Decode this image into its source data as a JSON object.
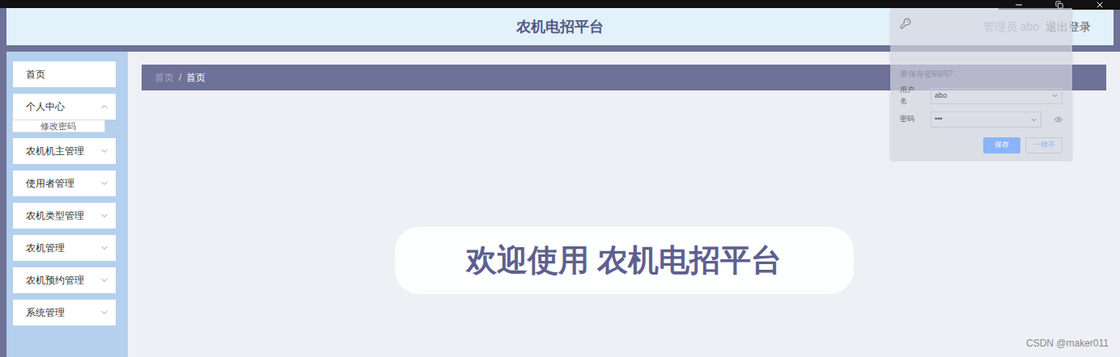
{
  "header": {
    "title": "农机电招平台",
    "user_label": "管理员 abo",
    "logout": "退出登录"
  },
  "sidebar": {
    "items": [
      {
        "label": "首页",
        "kind": "link",
        "expanded": false,
        "children": []
      },
      {
        "label": "个人中心",
        "kind": "menu",
        "expanded": true,
        "children": [
          "修改密码"
        ]
      },
      {
        "label": "农机机主管理",
        "kind": "menu",
        "expanded": false,
        "children": []
      },
      {
        "label": "使用者管理",
        "kind": "menu",
        "expanded": false,
        "children": []
      },
      {
        "label": "农机类型管理",
        "kind": "menu",
        "expanded": false,
        "children": []
      },
      {
        "label": "农机管理",
        "kind": "menu",
        "expanded": false,
        "children": []
      },
      {
        "label": "农机预约管理",
        "kind": "menu",
        "expanded": false,
        "children": []
      },
      {
        "label": "系统管理",
        "kind": "menu",
        "expanded": false,
        "children": []
      }
    ]
  },
  "breadcrumb": {
    "separator": "/",
    "items": [
      {
        "label": "首页",
        "current": false
      },
      {
        "label": "首页",
        "current": true
      }
    ]
  },
  "welcome": "欢迎使用 农机电招平台",
  "password_prompt": {
    "title": "要保存密码吗?",
    "fields": [
      {
        "label": "用户名",
        "value": "abo",
        "kind": "text"
      },
      {
        "label": "密码",
        "value": "•••",
        "kind": "password"
      }
    ],
    "buttons": [
      {
        "label": "保存",
        "primary": true
      },
      {
        "label": "一律不",
        "primary": false
      }
    ]
  },
  "watermark": "CSDN @maker011"
}
